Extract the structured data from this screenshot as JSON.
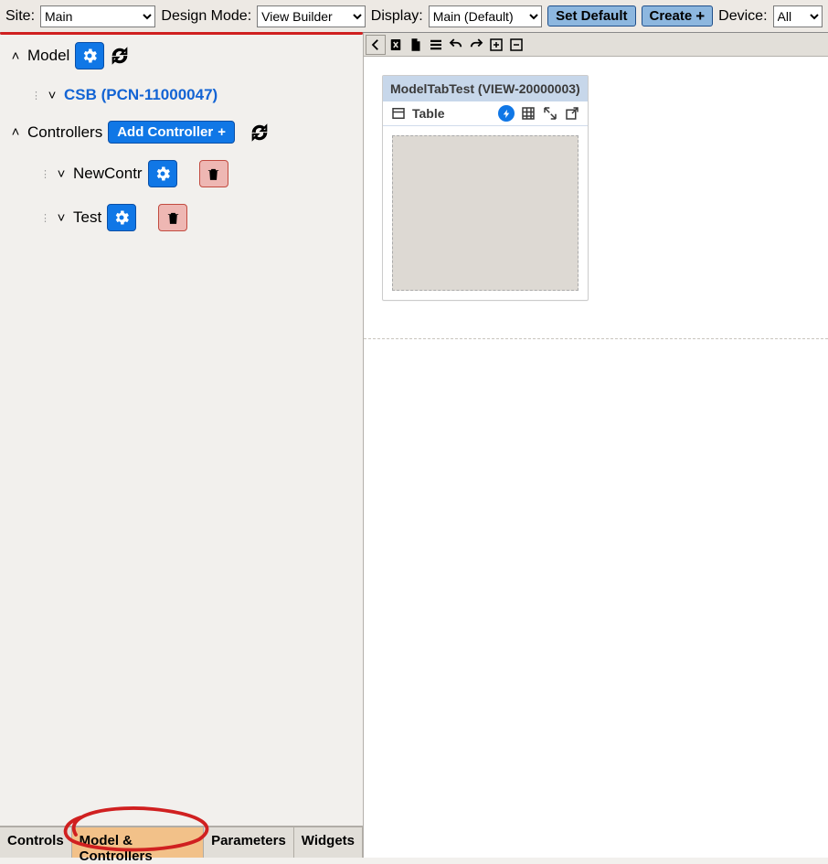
{
  "topbar": {
    "site_label": "Site:",
    "site_value": "Main",
    "mode_label": "Design Mode:",
    "mode_value": "View Builder",
    "display_label": "Display:",
    "display_value": "Main (Default)",
    "set_default": "Set Default",
    "create": "Create",
    "device_label": "Device:",
    "device_value": "All"
  },
  "tree": {
    "model_label": "Model",
    "model_child": "CSB (PCN-11000047)",
    "controllers_label": "Controllers",
    "add_controller": "Add Controller",
    "controller1": "NewContr",
    "controller2": "Test"
  },
  "bottom_tabs": {
    "t0": "Controls",
    "t1": "Model & Controllers",
    "t2": "Parameters",
    "t3": "Widgets"
  },
  "widget": {
    "title": "ModelTabTest (VIEW-20000003)",
    "type": "Table"
  }
}
